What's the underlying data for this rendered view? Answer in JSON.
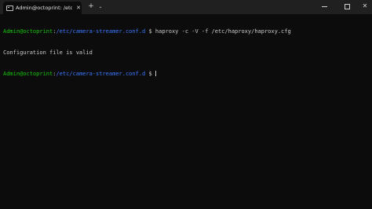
{
  "window": {
    "tab_title": "Admin@octoprint: /etc/came",
    "tab_close": "✕",
    "new_tab": "+",
    "dropdown": "⌄",
    "close": "✕"
  },
  "terminal": {
    "user": "Admin@octoprint",
    "colon": ":",
    "cwd": "/etc/camera-streamer.conf.d",
    "prompt_symbol": "$",
    "command": "haproxy -c -V -f /etc/haproxy/haproxy.cfg",
    "output": "Configuration file is valid"
  },
  "colors": {
    "background": "#0c0c0c",
    "titlebar": "#202020",
    "user": "#16c60c",
    "path": "#3b78ff",
    "text": "#cccccc"
  },
  "icons": {
    "tab": "terminal-icon",
    "new_tab": "plus-icon",
    "dropdown": "chevron-down-icon",
    "minimize": "minimize-icon",
    "maximize": "maximize-icon",
    "close": "close-icon"
  }
}
